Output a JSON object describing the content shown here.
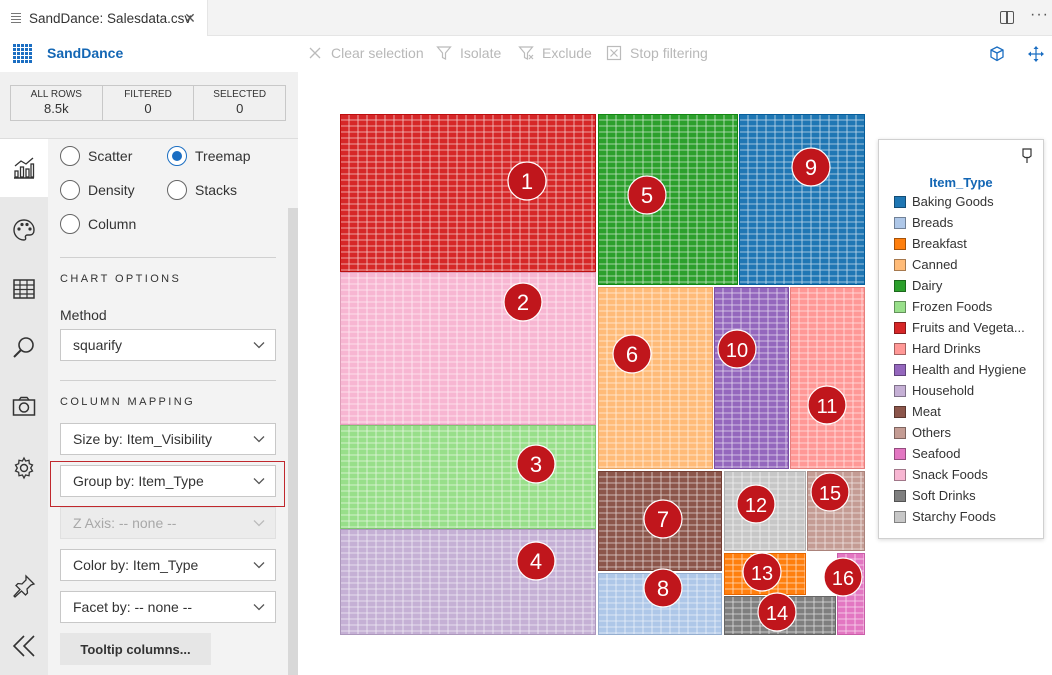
{
  "tab": {
    "title": "SandDance: Salesdata.csv",
    "close_glyph": "✕",
    "more_glyph": "···"
  },
  "app": {
    "brand": "SandDance"
  },
  "toolbar": {
    "clear_selection": "Clear selection",
    "isolate": "Isolate",
    "exclude": "Exclude",
    "stop_filtering": "Stop filtering"
  },
  "counters": [
    {
      "label": "ALL ROWS",
      "value": "8.5k"
    },
    {
      "label": "FILTERED",
      "value": "0"
    },
    {
      "label": "SELECTED",
      "value": "0"
    }
  ],
  "chart_types": {
    "scatter": "Scatter",
    "treemap": "Treemap",
    "density": "Density",
    "stacks": "Stacks",
    "column": "Column",
    "selected": "Treemap"
  },
  "chart_options": {
    "heading": "CHART OPTIONS",
    "method_label": "Method",
    "method_value": "squarify"
  },
  "column_mapping": {
    "heading": "COLUMN MAPPING",
    "size_by": "Size by: Item_Visibility",
    "group_by": "Group by: Item_Type",
    "z_axis": "Z Axis: -- none --",
    "color_by": "Color by: Item_Type",
    "facet_by": "Facet by: -- none --",
    "tooltip_button": "Tooltip columns..."
  },
  "rail_icons": [
    "chart-icon",
    "palette-icon",
    "table-icon",
    "search-icon",
    "camera-icon",
    "gear-icon",
    "pin-icon",
    "collapse-icon"
  ],
  "legend": {
    "title": "Item_Type",
    "items": [
      {
        "label": "Baking Goods",
        "color": "#1f77b4"
      },
      {
        "label": "Breads",
        "color": "#aec7e8"
      },
      {
        "label": "Breakfast",
        "color": "#ff7f0e"
      },
      {
        "label": "Canned",
        "color": "#ffbb78"
      },
      {
        "label": "Dairy",
        "color": "#2ca02c"
      },
      {
        "label": "Frozen Foods",
        "color": "#98df8a"
      },
      {
        "label": "Fruits and Vegeta...",
        "color": "#d62728"
      },
      {
        "label": "Hard Drinks",
        "color": "#ff9896"
      },
      {
        "label": "Health and Hygiene",
        "color": "#9467bd"
      },
      {
        "label": "Household",
        "color": "#c5b0d5"
      },
      {
        "label": "Meat",
        "color": "#8c564b"
      },
      {
        "label": "Others",
        "color": "#c49c94"
      },
      {
        "label": "Seafood",
        "color": "#e377c2"
      },
      {
        "label": "Snack Foods",
        "color": "#f7b6d2"
      },
      {
        "label": "Soft Drinks",
        "color": "#7f7f7f"
      },
      {
        "label": "Starchy Foods",
        "color": "#c7c7c7"
      }
    ]
  },
  "treemap_groups": [
    {
      "num": "1",
      "type": "Fruits and Vegeta...",
      "color": "#d62728"
    },
    {
      "num": "2",
      "type": "Snack Foods",
      "color": "#f7b6d2"
    },
    {
      "num": "3",
      "type": "Frozen Foods",
      "color": "#98df8a"
    },
    {
      "num": "4",
      "type": "Household",
      "color": "#c5b0d5"
    },
    {
      "num": "5",
      "type": "Dairy",
      "color": "#2ca02c"
    },
    {
      "num": "6",
      "type": "Canned",
      "color": "#ffbb78"
    },
    {
      "num": "7",
      "type": "Meat",
      "color": "#8c564b"
    },
    {
      "num": "8",
      "type": "Breads",
      "color": "#aec7e8"
    },
    {
      "num": "9",
      "type": "Baking Goods",
      "color": "#1f77b4"
    },
    {
      "num": "10",
      "type": "Health and Hygiene",
      "color": "#9467bd"
    },
    {
      "num": "11",
      "type": "Hard Drinks",
      "color": "#ff9896"
    },
    {
      "num": "12",
      "type": "Starchy Foods",
      "color": "#c7c7c7"
    },
    {
      "num": "13",
      "type": "Breakfast",
      "color": "#ff7f0e"
    },
    {
      "num": "14",
      "type": "Soft Drinks",
      "color": "#7f7f7f"
    },
    {
      "num": "15",
      "type": "Others",
      "color": "#c49c94"
    },
    {
      "num": "16",
      "type": "Seafood",
      "color": "#e377c2"
    }
  ],
  "colors": {
    "accent": "#1b6ec2",
    "brand": "#1366b4",
    "marker": "#c0161c",
    "highlight": "#c0282d"
  }
}
